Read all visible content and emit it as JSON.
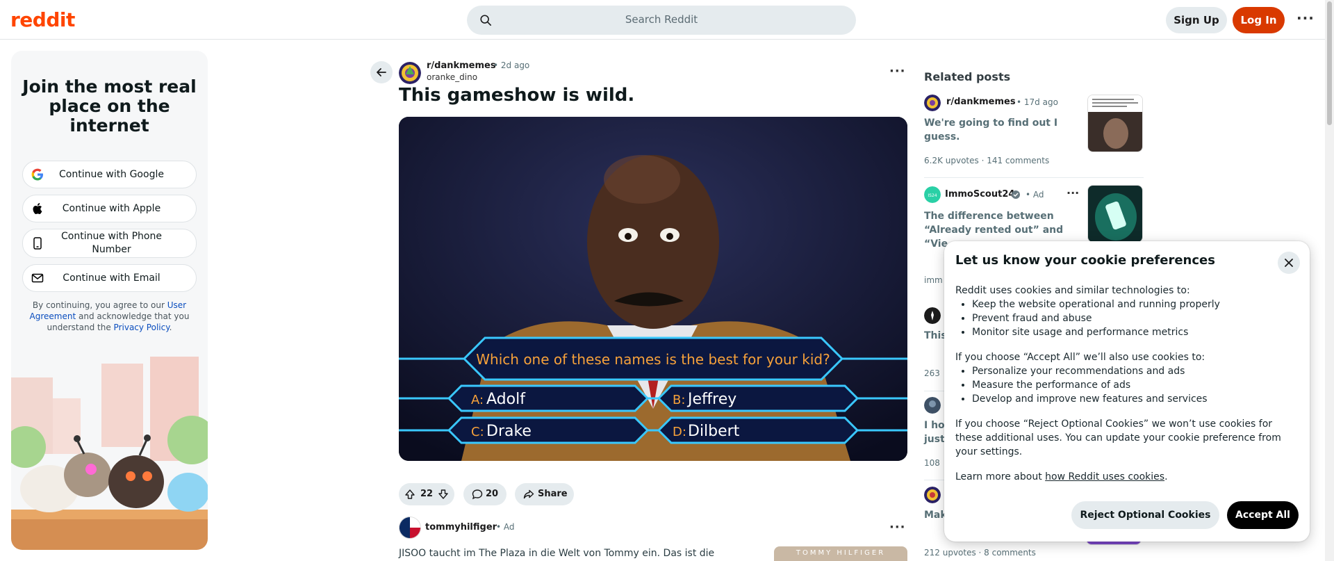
{
  "header": {
    "logo": "reddit",
    "search_placeholder": "Search Reddit",
    "signup_label": "Sign Up",
    "login_label": "Log In"
  },
  "login_panel": {
    "title": "Join the most real place on the internet",
    "buttons": [
      {
        "label": "Continue with Google",
        "icon": "google-icon"
      },
      {
        "label": "Continue with Apple",
        "icon": "apple-icon"
      },
      {
        "label": "Continue with Phone Number",
        "icon": "phone-icon"
      },
      {
        "label": "Continue with Email",
        "icon": "mail-icon"
      }
    ],
    "legal_prefix": "By continuing, you agree to our",
    "legal_link1": "User Agreement",
    "legal_middle": "and acknowledge that you understand the",
    "legal_link2": "Privacy Policy",
    "legal_suffix": "."
  },
  "post": {
    "subreddit": "r/dankmemes",
    "time": "• 2d ago",
    "author": "oranke_dino",
    "title": "This gameshow is wild.",
    "media": {
      "question": "Which one of these names is the best for your kid?",
      "answers": [
        {
          "letter": "A:",
          "text": "Adolf"
        },
        {
          "letter": "B:",
          "text": "Jeffrey"
        },
        {
          "letter": "C:",
          "text": "Drake"
        },
        {
          "letter": "D:",
          "text": "Dilbert"
        }
      ]
    },
    "votes": "22",
    "comments": "20",
    "share_label": "Share"
  },
  "ad": {
    "name": "tommyhilfiger",
    "tag": "• Ad",
    "text": "JISOO taucht im The Plaza in die Welt von Tommy ein. Das ist die",
    "image_text": "TOMMY HILFIGER"
  },
  "related": {
    "heading": "Related posts",
    "items": [
      {
        "sub": "r/dankmemes",
        "meta": "• 17d ago",
        "title": "We're going to find out I guess.",
        "stats": "6.2K upvotes · 141 comments"
      },
      {
        "sub": "ImmoScout24",
        "meta": "• Ad",
        "title": "The difference between “Already rented out” and “Vie",
        "stats": "imm"
      },
      {
        "sub": "",
        "meta": "",
        "title": "This",
        "stats": "263"
      },
      {
        "sub": "",
        "meta": "",
        "title": "I ho just",
        "stats": "108"
      },
      {
        "sub": "",
        "meta": "",
        "title": "Mak",
        "stats": "212 upvotes · 8 comments"
      }
    ]
  },
  "cookie": {
    "title": "Let us know your cookie preferences",
    "intro": "Reddit uses cookies and similar technologies to:",
    "list1": [
      "Keep the website operational and running properly",
      "Prevent fraud and abuse",
      "Monitor site usage and performance metrics"
    ],
    "accept_intro": "If you choose “Accept All” we’ll also use cookies to:",
    "list2": [
      "Personalize your recommendations and ads",
      "Measure the performance of ads",
      "Develop and improve new features and services"
    ],
    "reject_text": "If you choose “Reject Optional Cookies” we won’t use cookies for these additional uses. You can update your cookie preference from your settings.",
    "learn_prefix": "Learn more about",
    "learn_link": "how Reddit uses cookies",
    "learn_suffix": ".",
    "reject_label": "Reject Optional Cookies",
    "accept_label": "Accept All"
  },
  "colors": {
    "brand": "#ff4500",
    "login_button": "#d93900",
    "pill_bg": "#e5ebee"
  }
}
